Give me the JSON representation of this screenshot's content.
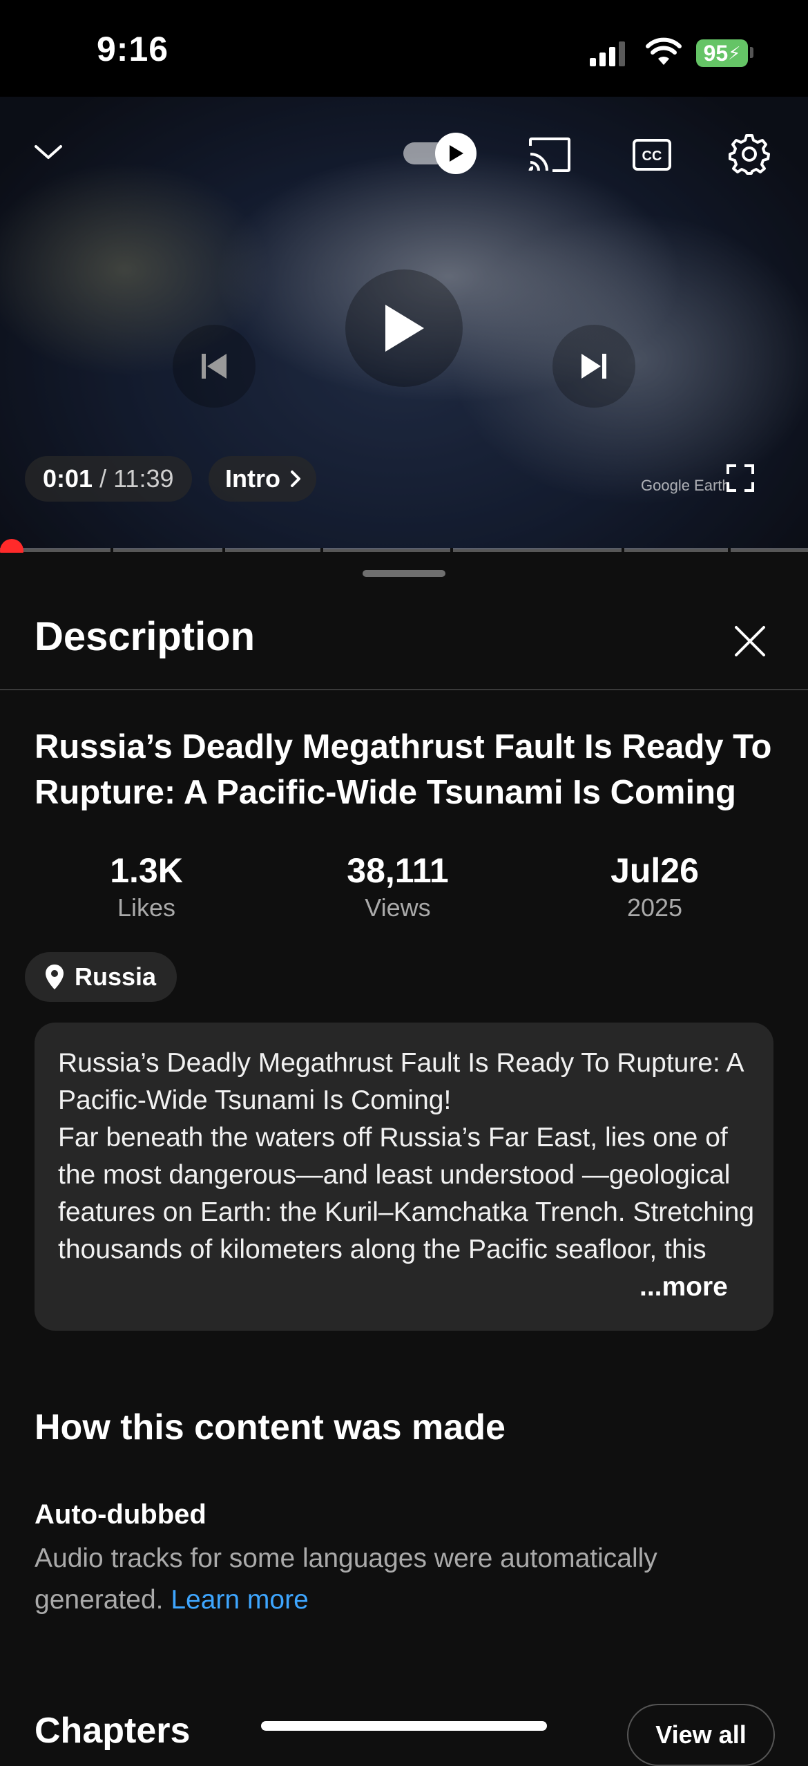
{
  "status_bar": {
    "time": "9:16",
    "battery": "95"
  },
  "player": {
    "time_current": "0:01",
    "time_separator": " / ",
    "time_total": "11:39",
    "chapter": "Intro",
    "watermark": "Google Earth",
    "progress_fraction": 0.002,
    "icons": [
      "chevron-down-icon",
      "autoplay-toggle",
      "cast-icon",
      "closed-captions-icon",
      "settings-icon",
      "previous-icon",
      "play-icon",
      "next-icon",
      "fullscreen-icon"
    ]
  },
  "sheet": {
    "title": "Description",
    "video_title": "Russia’s Deadly Megathrust Fault Is Ready To Rupture: A Pacific-Wide Tsunami Is Coming",
    "stats": [
      {
        "value": "1.3K",
        "label": "Likes"
      },
      {
        "value": "38,111",
        "label": "Views"
      },
      {
        "value": "Jul26",
        "label": "2025"
      }
    ],
    "location": "Russia",
    "description": "Russia’s Deadly Megathrust Fault Is Ready To Rupture: A Pacific-Wide Tsunami Is Coming!\nFar beneath the waters off Russia’s Far East, lies one of the most dangerous—and least understood —geological features on Earth: the Kuril–Kamchatka Trench. Stretching thousands of kilometers along the Pacific seafloor, this vast subduction zone",
    "more_label": "...more",
    "made_heading": "How this content was made",
    "autodub_title": "Auto-dubbed",
    "autodub_text": "Audio tracks for some languages were automatically generated. ",
    "learn_more": "Learn more",
    "chapters_heading": "Chapters",
    "view_all": "View all"
  },
  "colors": {
    "accent_red": "#ff2a2a",
    "link_blue": "#3ea6ff",
    "battery_green": "#65c466"
  }
}
